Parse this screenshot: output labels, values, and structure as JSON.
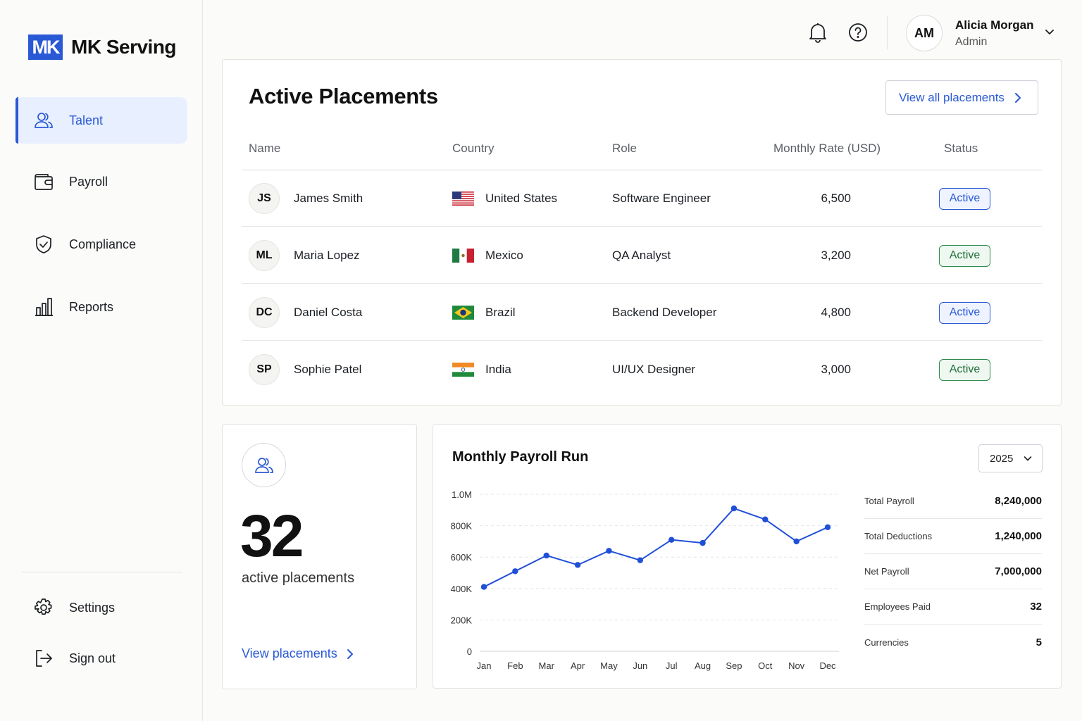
{
  "brand": {
    "mark": "MK",
    "name": "MK Serving"
  },
  "sidebar": {
    "items": [
      {
        "label": "Talent",
        "icon": "users-icon"
      },
      {
        "label": "Payroll",
        "icon": "wallet-icon"
      },
      {
        "label": "Compliance",
        "icon": "shield-check-icon"
      },
      {
        "label": "Reports",
        "icon": "bar-chart-icon"
      }
    ],
    "bottom": [
      {
        "label": "Settings",
        "icon": "gear-icon"
      },
      {
        "label": "Sign out",
        "icon": "sign-out-icon"
      }
    ]
  },
  "header": {
    "user": {
      "initials": "AM",
      "name": "Alicia Morgan",
      "role": "Admin"
    }
  },
  "placements": {
    "title": "Active Placements",
    "view_all": "View all placements",
    "columns": [
      "Name",
      "Country",
      "Role",
      "Monthly Rate (USD)",
      "Status"
    ],
    "rows": [
      {
        "initials": "JS",
        "name": "James Smith",
        "country": "United States",
        "flag": "us",
        "role": "Software Engineer",
        "rate": "6,500",
        "status": "Active",
        "status_color": "blue"
      },
      {
        "initials": "ML",
        "name": "Maria Lopez",
        "country": "Mexico",
        "flag": "mx",
        "role": "QA Analyst",
        "rate": "3,200",
        "status": "Active",
        "status_color": "green"
      },
      {
        "initials": "DC",
        "name": "Daniel Costa",
        "country": "Brazil",
        "flag": "br",
        "role": "Backend Developer",
        "rate": "4,800",
        "status": "Active",
        "status_color": "blue"
      },
      {
        "initials": "SP",
        "name": "Sophie Patel",
        "country": "India",
        "flag": "in",
        "role": "UI/UX Designer",
        "rate": "3,000",
        "status": "Active",
        "status_color": "green"
      }
    ]
  },
  "stat": {
    "value": "32",
    "label": "active placements",
    "link": "View placements"
  },
  "payroll": {
    "title": "Monthly Payroll Run",
    "year": "2025",
    "summary": [
      {
        "label": "Total Payroll",
        "value": "8,240,000"
      },
      {
        "label": "Total Deductions",
        "value": "1,240,000"
      },
      {
        "label": "Net Payroll",
        "value": "7,000,000"
      },
      {
        "label": "Employees Paid",
        "value": "32"
      },
      {
        "label": "Currencies",
        "value": "5"
      }
    ]
  },
  "chart_data": {
    "type": "line",
    "title": "Monthly Payroll Run",
    "x": [
      "Jan",
      "Feb",
      "Mar",
      "Apr",
      "May",
      "Jun",
      "Jul",
      "Aug",
      "Sep",
      "Oct",
      "Nov",
      "Dec"
    ],
    "values": [
      410000,
      510000,
      610000,
      550000,
      640000,
      580000,
      710000,
      690000,
      910000,
      840000,
      700000,
      790000
    ],
    "y_ticks": [
      0,
      200000,
      400000,
      600000,
      800000,
      1000000
    ],
    "y_tick_labels": [
      "0",
      "200K",
      "400K",
      "600K",
      "800K",
      "1.0M"
    ],
    "ylim": [
      0,
      1000000
    ],
    "grid": "horizontal dashed",
    "color": "#1f4fd8"
  },
  "colors": {
    "accent": "#2a59d6",
    "active_blue": "#2a59d6",
    "active_green": "#2e8a4a"
  }
}
